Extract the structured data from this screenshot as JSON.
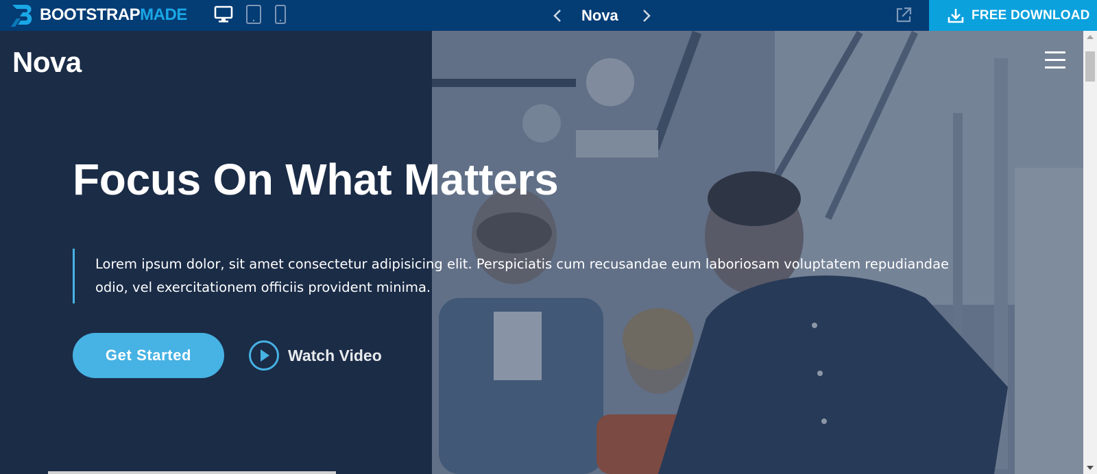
{
  "topbar": {
    "brand": {
      "part1": "BOOTSTRAP",
      "part2": "MADE"
    },
    "devices": [
      "desktop-icon",
      "tablet-icon",
      "phone-icon"
    ],
    "demo_name": "Nova",
    "download_label": "FREE DOWNLOAD",
    "colors": {
      "bar": "#043c74",
      "download": "#0aa1dd",
      "brand_accent": "#1aa7e6"
    }
  },
  "hero": {
    "logo": "Nova",
    "title": "Focus On What Matters",
    "description": "Lorem ipsum dolor, sit amet consectetur adipisicing elit. Perspiciatis cum recusandae eum laboriosam voluptatem repudiandae odio, vel exercitationem officiis provident minima.",
    "get_started_label": "Get Started",
    "watch_video_label": "Watch Video",
    "colors": {
      "background": "#1b2c47",
      "accent": "#47b2e4"
    }
  }
}
